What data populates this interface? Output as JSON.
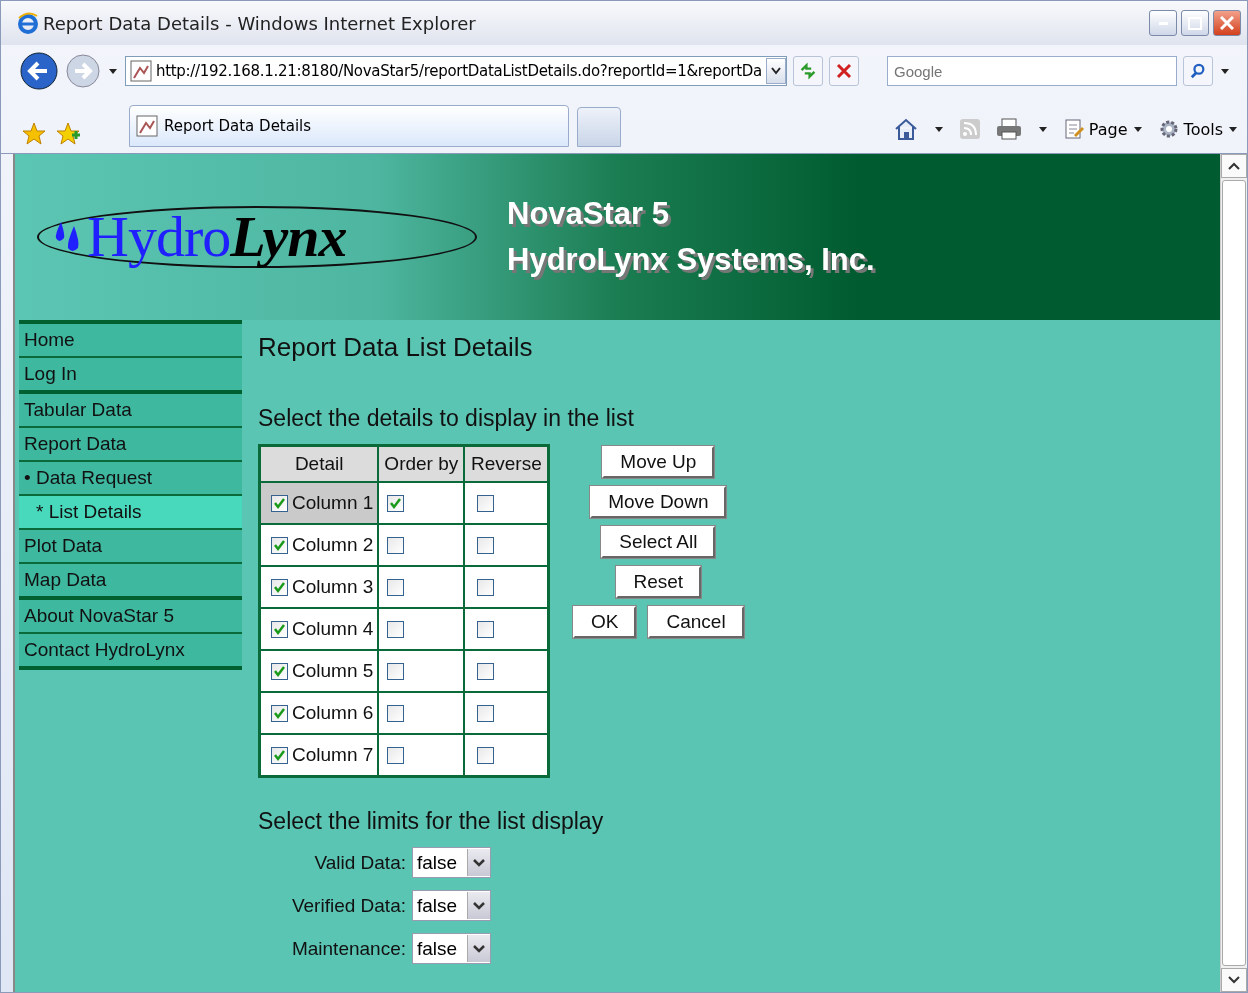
{
  "window": {
    "title": "Report Data Details - Windows Internet Explorer"
  },
  "address_bar": {
    "value": "http://192.168.1.21:8180/NovaStar5/reportDataListDetails.do?reportId=1&reportDa"
  },
  "search": {
    "placeholder": "Google"
  },
  "tabs": [
    {
      "label": "Report Data Details",
      "selected": true
    }
  ],
  "command_bar": [
    {
      "label": "Page"
    },
    {
      "label": "Tools"
    }
  ],
  "header": {
    "logo": [
      "Hydro",
      "Lynx"
    ],
    "product": "NovaStar 5",
    "company": "HydroLynx Systems, Inc."
  },
  "sidebar": {
    "groups": [
      {
        "items": [
          {
            "label": "Home",
            "selected": false
          },
          {
            "label": "Log In",
            "selected": false
          }
        ]
      },
      {
        "items": [
          {
            "label": "Tabular Data",
            "selected": false
          },
          {
            "label": "Report Data",
            "selected": false,
            "children": [
              {
                "label": "• Data Request",
                "selected": false,
                "children": [
                  {
                    "label": "* List Details",
                    "selected": true
                  }
                ]
              }
            ]
          },
          {
            "label": "Plot Data",
            "selected": false
          },
          {
            "label": "Map Data",
            "selected": false
          }
        ]
      },
      {
        "items": [
          {
            "label": "About NovaStar 5",
            "selected": false
          },
          {
            "label": "Contact HydroLynx",
            "selected": false
          }
        ]
      }
    ]
  },
  "page_title": "Report Data List Details",
  "details_heading": "Select the details to display in the list",
  "table": {
    "columns": [
      "Detail",
      "Order by",
      "Reverse"
    ],
    "rows": [
      {
        "detail": "Column 1",
        "shown": true,
        "order_by": true,
        "reverse": false,
        "selected": true
      },
      {
        "detail": "Column 2",
        "shown": true,
        "order_by": false,
        "reverse": false,
        "selected": false
      },
      {
        "detail": "Column 3",
        "shown": true,
        "order_by": false,
        "reverse": false,
        "selected": false
      },
      {
        "detail": "Column 4",
        "shown": true,
        "order_by": false,
        "reverse": false,
        "selected": false
      },
      {
        "detail": "Column 5",
        "shown": true,
        "order_by": false,
        "reverse": false,
        "selected": false
      },
      {
        "detail": "Column 6",
        "shown": true,
        "order_by": false,
        "reverse": false,
        "selected": false
      },
      {
        "detail": "Column 7",
        "shown": true,
        "order_by": false,
        "reverse": false,
        "selected": false
      }
    ]
  },
  "buttons": [
    [
      "Move Up"
    ],
    [
      "Move Down"
    ],
    [
      "Select All"
    ],
    [
      "Reset"
    ],
    [
      "OK",
      "Cancel"
    ]
  ],
  "limits_heading": "Select the limits for the list display",
  "limits": [
    {
      "label": "Valid Data:",
      "value": "false"
    },
    {
      "label": "Verified Data:",
      "value": "false"
    },
    {
      "label": "Maintenance:",
      "value": "false"
    }
  ]
}
